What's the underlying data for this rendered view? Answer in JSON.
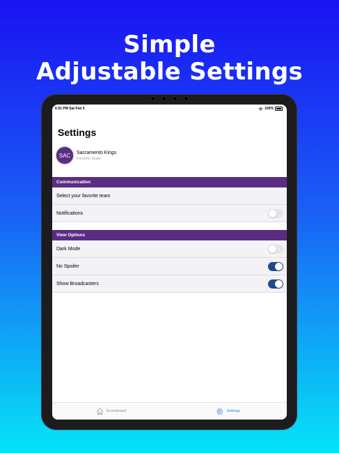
{
  "promo": {
    "line1": "Simple",
    "line2": "Adjustable Settings"
  },
  "status_bar": {
    "time_date": "6:51 PM   Sat Feb 5",
    "battery": "100%"
  },
  "page": {
    "title": "Settings"
  },
  "favorite_team": {
    "avatar_text": "SAC",
    "name": "Sacramento Kings",
    "subtitle": "Favorite Team"
  },
  "sections": {
    "communication": {
      "header": "Communication",
      "select_team_label": "Select your favorite team",
      "notifications_label": "Notifications",
      "notifications_on": false
    },
    "view_options": {
      "header": "View Options",
      "dark_mode_label": "Dark Mode",
      "dark_mode_on": false,
      "no_spoiler_label": "No Spoiler",
      "no_spoiler_on": true,
      "broadcasters_label": "Show Broadcasters",
      "broadcasters_on": true
    }
  },
  "tab_bar": {
    "scoreboard": "Scoreboard",
    "settings": "Settings",
    "active": "settings"
  },
  "colors": {
    "accent_purple": "#5a2d82",
    "toggle_on": "#22488f",
    "tab_active": "#3b82f6"
  },
  "icons": {
    "scoreboard": "house-icon",
    "settings": "gear-icon"
  }
}
